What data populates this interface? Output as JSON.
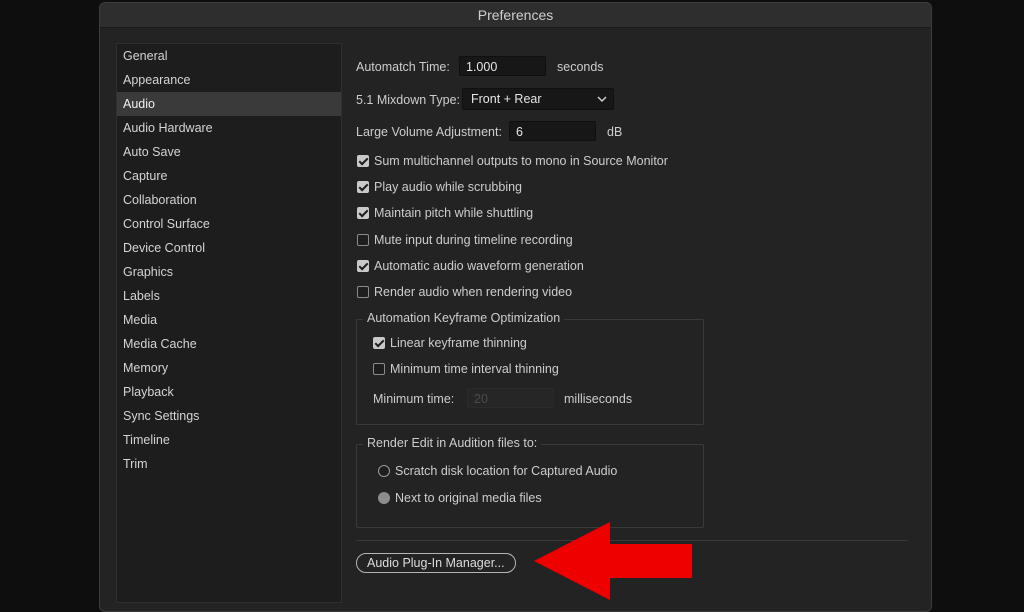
{
  "window": {
    "title": "Preferences"
  },
  "sidebar": {
    "items": [
      {
        "label": "General"
      },
      {
        "label": "Appearance"
      },
      {
        "label": "Audio"
      },
      {
        "label": "Audio Hardware"
      },
      {
        "label": "Auto Save"
      },
      {
        "label": "Capture"
      },
      {
        "label": "Collaboration"
      },
      {
        "label": "Control Surface"
      },
      {
        "label": "Device Control"
      },
      {
        "label": "Graphics"
      },
      {
        "label": "Labels"
      },
      {
        "label": "Media"
      },
      {
        "label": "Media Cache"
      },
      {
        "label": "Memory"
      },
      {
        "label": "Playback"
      },
      {
        "label": "Sync Settings"
      },
      {
        "label": "Timeline"
      },
      {
        "label": "Trim"
      }
    ],
    "selected": "Audio"
  },
  "audio": {
    "automatch": {
      "label": "Automatch Time:",
      "value": "1.000",
      "unit": "seconds"
    },
    "mixdown": {
      "label": "5.1 Mixdown Type:",
      "value": "Front + Rear"
    },
    "large_volume": {
      "label": "Large Volume Adjustment:",
      "value": "6",
      "unit": "dB"
    },
    "checkboxes": [
      {
        "label": "Sum multichannel outputs to mono in Source Monitor",
        "checked": true
      },
      {
        "label": "Play audio while scrubbing",
        "checked": true
      },
      {
        "label": "Maintain pitch while shuttling",
        "checked": true
      },
      {
        "label": "Mute input during timeline recording",
        "checked": false
      },
      {
        "label": "Automatic audio waveform generation",
        "checked": true
      },
      {
        "label": "Render audio when rendering video",
        "checked": false
      }
    ],
    "keyframe_group": {
      "title": "Automation Keyframe Optimization",
      "linear": {
        "label": "Linear keyframe thinning",
        "checked": true
      },
      "min_interval": {
        "label": "Minimum time interval thinning",
        "checked": false
      },
      "min_time": {
        "label": "Minimum time:",
        "value": "20",
        "unit": "milliseconds"
      }
    },
    "render_group": {
      "title": "Render Edit in Audition files to:",
      "options": [
        {
          "label": "Scratch disk location for Captured Audio",
          "selected": false
        },
        {
          "label": "Next to original media files",
          "selected": true
        }
      ]
    },
    "plugin_button": {
      "label": "Audio Plug-In Manager..."
    }
  },
  "annotation": {
    "arrow_color": "#ee0000"
  },
  "colors": {
    "background": "#0e0e0e",
    "dialog": "#232323",
    "selected_item": "#3a3a3a"
  }
}
